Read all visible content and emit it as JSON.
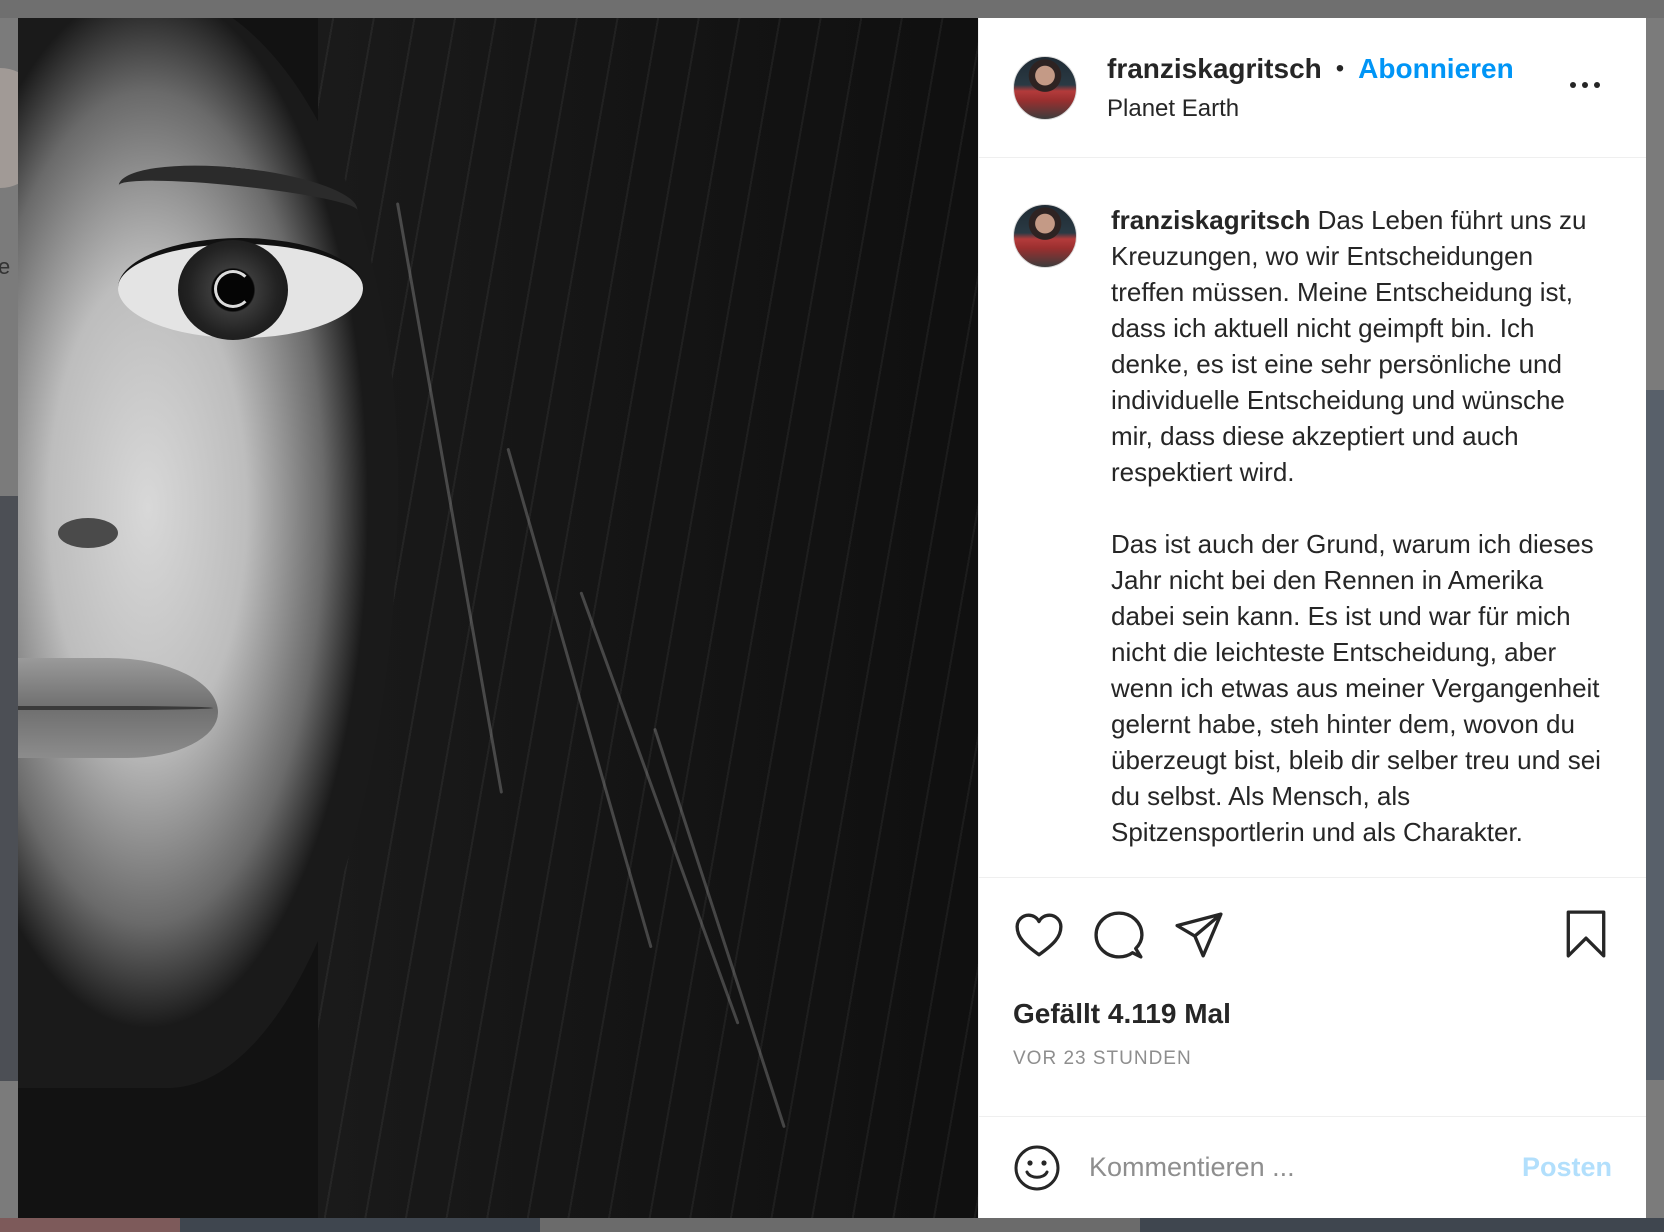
{
  "post": {
    "username": "franziskagritsch",
    "follow_label": "Abonnieren",
    "separator": "•",
    "location": "Planet Earth",
    "caption_username": "franziskagritsch",
    "caption_text": " Das Leben führt uns zu Kreuzungen, wo wir Entscheidungen treffen müssen. Meine Entscheidung ist, dass ich aktuell nicht geimpft bin. Ich denke, es ist eine sehr persönliche und individuelle Entscheidung und wünsche mir, dass diese akzeptiert und auch respektiert wird.\n\nDas ist auch der Grund, warum ich dieses Jahr nicht bei den Rennen in Amerika dabei sein kann. Es ist und war für mich nicht die leichteste Entscheidung, aber wenn ich etwas aus meiner Vergangenheit gelernt habe, steh hinter dem, wovon du überzeugt bist, bleib dir selber treu und sei du selbst. Als Mensch, als Spitzensportlerin und als Charakter.",
    "likes": "Gefällt 4.119 Mal",
    "timestamp": "VOR 23 STUNDEN"
  },
  "actions": {
    "like_icon": "heart-icon",
    "comment_icon": "comment-bubble-icon",
    "share_icon": "paper-plane-icon",
    "save_icon": "bookmark-icon",
    "more_icon": "more-horizontal-icon"
  },
  "comment": {
    "placeholder": "Kommentieren ...",
    "post_label": "Posten",
    "emoji_icon": "smiley-icon"
  },
  "colors": {
    "accent": "#0095f6",
    "post_disabled": "#b2dffc",
    "text": "#262626",
    "muted": "#8e8e8e"
  }
}
